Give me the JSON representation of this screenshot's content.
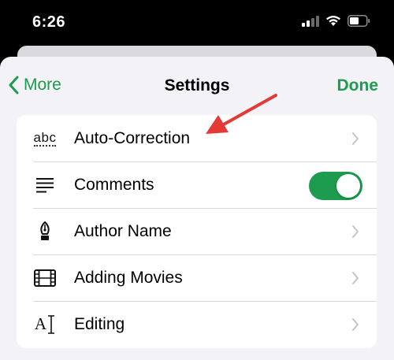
{
  "status": {
    "time": "6:26"
  },
  "nav": {
    "back_label": "More",
    "title": "Settings",
    "done_label": "Done"
  },
  "rows": [
    {
      "label": "Auto-Correction",
      "icon": "spellcheck-icon",
      "accessory": "chevron"
    },
    {
      "label": "Comments",
      "icon": "comment-lines-icon",
      "accessory": "toggle",
      "toggle_on": true
    },
    {
      "label": "Author Name",
      "icon": "pen-nib-icon",
      "accessory": "chevron"
    },
    {
      "label": "Adding Movies",
      "icon": "film-icon",
      "accessory": "chevron"
    },
    {
      "label": "Editing",
      "icon": "text-cursor-icon",
      "accessory": "chevron"
    }
  ],
  "icon_glyphs": {
    "abc": "abc",
    "ai": "A"
  },
  "colors": {
    "accent": "#1d9b4e",
    "annotation_arrow": "#e53935"
  }
}
